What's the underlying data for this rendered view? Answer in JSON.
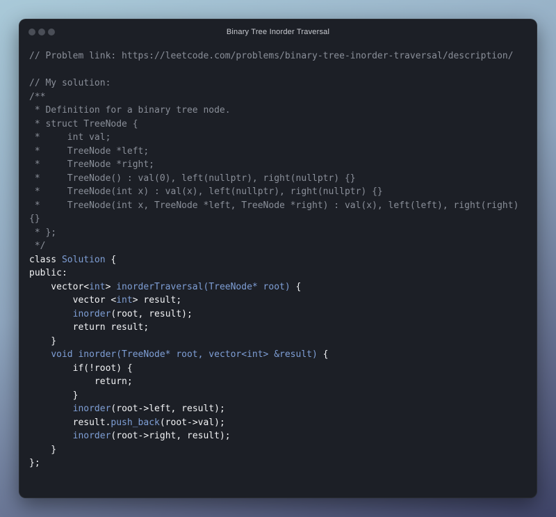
{
  "window": {
    "title": "Binary Tree Inorder Traversal"
  },
  "code": {
    "lines": [
      [
        {
          "t": "// Problem link: https://leetcode.com/problems/binary-tree-inorder-traversal/description/",
          "c": "comment"
        }
      ],
      [],
      [
        {
          "t": "// My solution:",
          "c": "comment"
        }
      ],
      [
        {
          "t": "/**",
          "c": "comment"
        }
      ],
      [
        {
          "t": " * Definition for a binary tree node.",
          "c": "comment"
        }
      ],
      [
        {
          "t": " * struct TreeNode {",
          "c": "comment"
        }
      ],
      [
        {
          "t": " *     int val;",
          "c": "comment"
        }
      ],
      [
        {
          "t": " *     TreeNode *left;",
          "c": "comment"
        }
      ],
      [
        {
          "t": " *     TreeNode *right;",
          "c": "comment"
        }
      ],
      [
        {
          "t": " *     TreeNode() : val(0), left(nullptr), right(nullptr) {}",
          "c": "comment"
        }
      ],
      [
        {
          "t": " *     TreeNode(int x) : val(x), left(nullptr), right(nullptr) {}",
          "c": "comment"
        }
      ],
      [
        {
          "t": " *     TreeNode(int x, TreeNode *left, TreeNode *right) : val(x), left(left), right(right)",
          "c": "comment"
        }
      ],
      [
        {
          "t": "{}",
          "c": "comment"
        }
      ],
      [
        {
          "t": " * };",
          "c": "comment"
        }
      ],
      [
        {
          "t": " */",
          "c": "comment"
        }
      ],
      [
        {
          "t": "class ",
          "c": "kw"
        },
        {
          "t": "Solution",
          "c": "type"
        },
        {
          "t": " {",
          "c": "plain"
        }
      ],
      [
        {
          "t": "public:",
          "c": "kw"
        }
      ],
      [
        {
          "t": "    vector<",
          "c": "plain"
        },
        {
          "t": "int",
          "c": "type"
        },
        {
          "t": "> ",
          "c": "plain"
        },
        {
          "t": "inorderTraversal(TreeNode* root)",
          "c": "func"
        },
        {
          "t": " {",
          "c": "plain"
        }
      ],
      [
        {
          "t": "        vector <",
          "c": "plain"
        },
        {
          "t": "int",
          "c": "type"
        },
        {
          "t": "> result;",
          "c": "plain"
        }
      ],
      [
        {
          "t": "        ",
          "c": "plain"
        },
        {
          "t": "inorder",
          "c": "func"
        },
        {
          "t": "(root, result);",
          "c": "plain"
        }
      ],
      [
        {
          "t": "        return result;",
          "c": "kw"
        }
      ],
      [
        {
          "t": "    }",
          "c": "plain"
        }
      ],
      [
        {
          "t": "    ",
          "c": "plain"
        },
        {
          "t": "void inorder(TreeNode* root, vector<int> &result)",
          "c": "func"
        },
        {
          "t": " {",
          "c": "plain"
        }
      ],
      [
        {
          "t": "        if(!root) {",
          "c": "kw"
        }
      ],
      [
        {
          "t": "            return;",
          "c": "kw"
        }
      ],
      [
        {
          "t": "        }",
          "c": "plain"
        }
      ],
      [
        {
          "t": "        ",
          "c": "plain"
        },
        {
          "t": "inorder",
          "c": "func"
        },
        {
          "t": "(root->left, result);",
          "c": "plain"
        }
      ],
      [
        {
          "t": "        result.",
          "c": "plain"
        },
        {
          "t": "push_back",
          "c": "func"
        },
        {
          "t": "(root->val);",
          "c": "plain"
        }
      ],
      [
        {
          "t": "        ",
          "c": "plain"
        },
        {
          "t": "inorder",
          "c": "func"
        },
        {
          "t": "(root->right, result);",
          "c": "plain"
        }
      ],
      [
        {
          "t": "    }",
          "c": "plain"
        }
      ],
      [
        {
          "t": "};",
          "c": "plain"
        }
      ]
    ]
  }
}
